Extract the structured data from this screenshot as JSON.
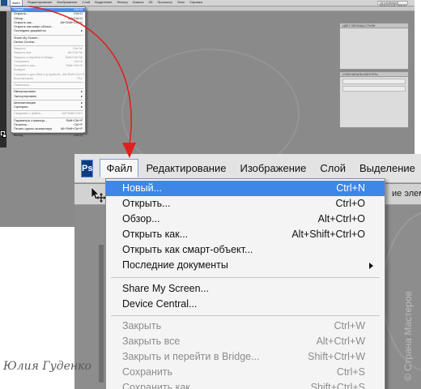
{
  "thumbnail": {
    "menu": [
      "Файл",
      "Редактирование",
      "Изображение",
      "Слой",
      "Выделение",
      "Фильтр",
      "Анализ",
      "3D",
      "Просмотр",
      "Окно",
      "Справка"
    ],
    "workspace_label": "ОСНОВНАЯ РАБОЧАЯ СРЕДА",
    "panel1_tabs": "ЦВЕТ   ОБРАЗЦЫ   СТИЛИ",
    "panel2_tabs": "СЛОИ   КАНАЛЫ   КОНТУРЫ",
    "items": [
      {
        "label": "Новый...",
        "shortcut": "Ctrl+N",
        "state": "highlighted"
      },
      {
        "label": "Открыть...",
        "shortcut": "Ctrl+O"
      },
      {
        "label": "Обзор...",
        "shortcut": "Alt+Ctrl+O"
      },
      {
        "label": "Открыть как...",
        "shortcut": "Alt+Shift+Ctrl+O"
      },
      {
        "label": "Открыть как смарт-объект...",
        "shortcut": ""
      },
      {
        "label": "Последние документы",
        "shortcut": "▸"
      },
      {
        "sep": true
      },
      {
        "label": "Share My Screen...",
        "shortcut": ""
      },
      {
        "label": "Device Central...",
        "shortcut": ""
      },
      {
        "sep": true
      },
      {
        "label": "Закрыть",
        "shortcut": "Ctrl+W",
        "state": "disabled"
      },
      {
        "label": "Закрыть все",
        "shortcut": "Alt+Ctrl+W",
        "state": "disabled"
      },
      {
        "label": "Закрыть и перейти в Bridge...",
        "shortcut": "Shift+Ctrl+W",
        "state": "disabled"
      },
      {
        "label": "Сохранить",
        "shortcut": "Ctrl+S",
        "state": "disabled"
      },
      {
        "label": "Сохранить как...",
        "shortcut": "Shift+Ctrl+S",
        "state": "disabled"
      },
      {
        "label": "Возврат",
        "shortcut": "",
        "state": "disabled"
      },
      {
        "label": "Сохранить для Web и устройств...",
        "shortcut": "Alt+Shift+Ctrl+S",
        "state": "disabled"
      },
      {
        "label": "Восстановить",
        "shortcut": "F12",
        "state": "disabled"
      },
      {
        "sep": true
      },
      {
        "label": "Поместить...",
        "shortcut": "",
        "state": "disabled"
      },
      {
        "sep": true
      },
      {
        "label": "Импортировать",
        "shortcut": "▸"
      },
      {
        "label": "Экспортировать",
        "shortcut": "▸"
      },
      {
        "sep": true
      },
      {
        "label": "Автоматизация",
        "shortcut": "▸"
      },
      {
        "label": "Сценарии",
        "shortcut": "▸"
      },
      {
        "sep": true
      },
      {
        "label": "Сведения о файле...",
        "shortcut": "Alt+Shift+Ctrl+I",
        "state": "disabled"
      },
      {
        "sep": true
      },
      {
        "label": "Параметры страницы...",
        "shortcut": "Shift+Ctrl+P"
      },
      {
        "label": "Печатать...",
        "shortcut": "Ctrl+P"
      },
      {
        "label": "Печать одного экземпляра",
        "shortcut": "Alt+Shift+Ctrl+P"
      },
      {
        "sep": true
      },
      {
        "label": "Выход",
        "shortcut": "Ctrl+Q"
      }
    ]
  },
  "zoom": {
    "logo": "Ps",
    "menu": [
      "Файл",
      "Редактирование",
      "Изображение",
      "Слой",
      "Выделение",
      "Ф"
    ],
    "options_text": "ие элеме",
    "items": [
      {
        "label": "Новый...",
        "shortcut": "Ctrl+N",
        "state": "highlighted"
      },
      {
        "label": "Открыть...",
        "shortcut": "Ctrl+O"
      },
      {
        "label": "Обзор...",
        "shortcut": "Alt+Ctrl+O"
      },
      {
        "label": "Открыть как...",
        "shortcut": "Alt+Shift+Ctrl+O"
      },
      {
        "label": "Открыть как смарт-объект...",
        "shortcut": ""
      },
      {
        "label": "Последние документы",
        "shortcut": "",
        "submenu": true
      },
      {
        "sep": true
      },
      {
        "label": "Share My Screen...",
        "shortcut": ""
      },
      {
        "label": "Device Central...",
        "shortcut": ""
      },
      {
        "sep": true
      },
      {
        "label": "Закрыть",
        "shortcut": "Ctrl+W",
        "state": "disabled"
      },
      {
        "label": "Закрыть все",
        "shortcut": "Alt+Ctrl+W",
        "state": "disabled"
      },
      {
        "label": "Закрыть и перейти в Bridge...",
        "shortcut": "Shift+Ctrl+W",
        "state": "disabled"
      },
      {
        "label": "Сохранить",
        "shortcut": "Ctrl+S",
        "state": "disabled"
      },
      {
        "label": "Сохранить как",
        "shortcut": "Shift+Ctrl+S",
        "state": "disabled"
      }
    ]
  },
  "watermarks": {
    "author": "Юлия Гуденко",
    "site": "© Страна Мастеров"
  },
  "colors": {
    "highlight": "#3e86e8",
    "arrow": "#e02020",
    "workspace": "#8d8d8d"
  }
}
